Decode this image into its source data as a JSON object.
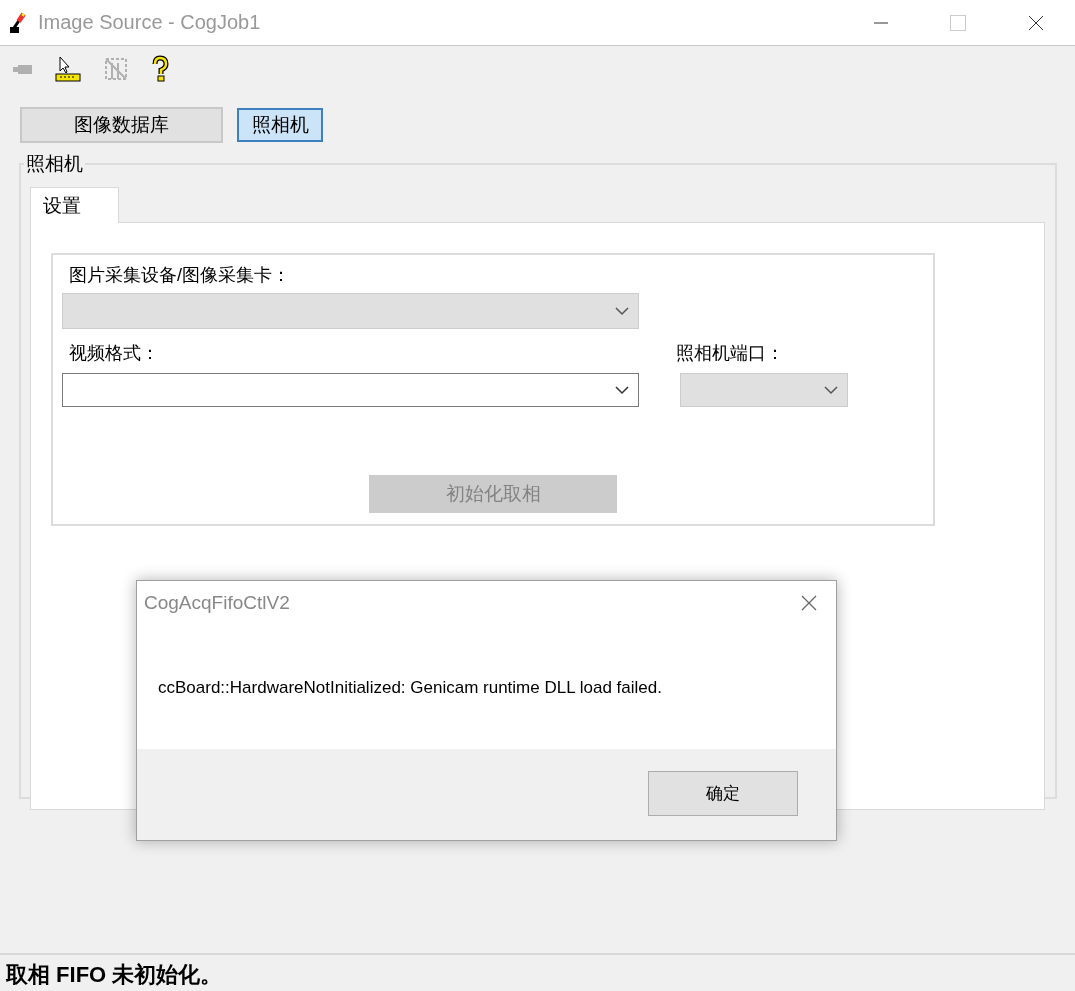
{
  "window": {
    "title": "Image Source - CogJob1",
    "active": false
  },
  "toolbar": [
    {
      "kind": "camera",
      "disabled": true
    },
    {
      "kind": "ruler",
      "disabled": false
    },
    {
      "kind": "grid",
      "disabled": true
    },
    {
      "kind": "help",
      "disabled": false
    }
  ],
  "source_buttons": [
    {
      "label": "图像数据库",
      "selected": false
    },
    {
      "label": "照相机",
      "selected": true
    }
  ],
  "group": {
    "title": "照相机"
  },
  "tabs": [
    {
      "label": "设置",
      "selected": true
    }
  ],
  "settings": {
    "device_label": "图片采集设备/图像采集卡：",
    "device_combo": {
      "disabled": true
    },
    "video_format_label": "视频格式：",
    "video_format_combo": {
      "disabled": false
    },
    "port_label": "照相机端口：",
    "port_combo": {
      "disabled": true
    },
    "init_button": {
      "label": "初始化取相",
      "disabled": true
    }
  },
  "dialog": {
    "title": "CogAcqFifoCtlV2",
    "message": "ccBoard::HardwareNotInitialized: Genicam runtime DLL load failed.",
    "button": "确定"
  },
  "status_bar": {
    "text": "取相 FIFO 未初始化。"
  }
}
